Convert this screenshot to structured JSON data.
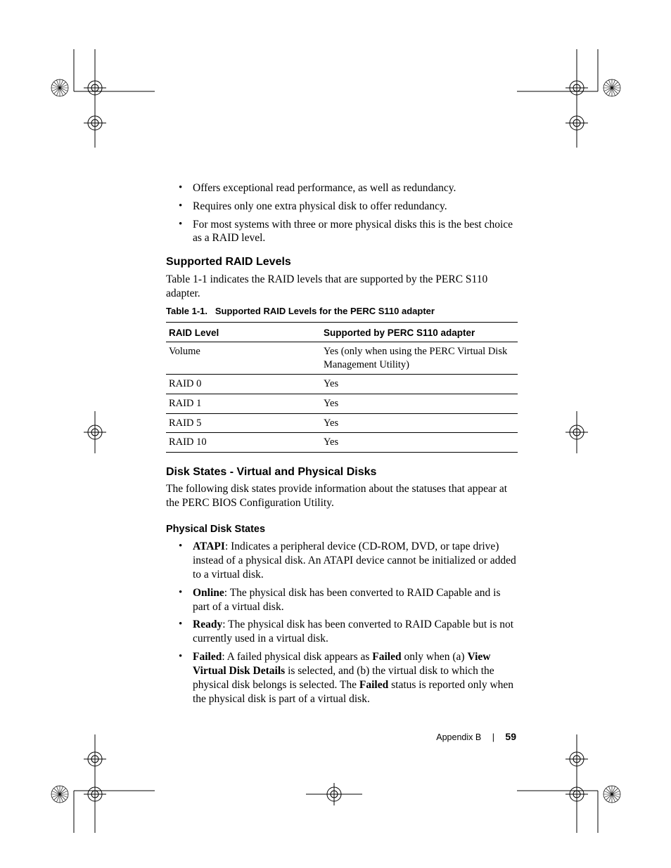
{
  "bullets_top": [
    "Offers exceptional read performance, as well as redundancy.",
    "Requires only one extra physical disk to offer redundancy.",
    "For most systems with three or more physical disks this is the best choice as a RAID level."
  ],
  "section1": {
    "heading": "Supported RAID Levels",
    "para": "Table 1-1 indicates the RAID levels that are supported by the PERC S110 adapter.",
    "table_caption_prefix": "Table 1-1.",
    "table_caption_rest": "Supported RAID Levels for the PERC S110 adapter",
    "table_headers": [
      "RAID Level",
      "Supported by PERC S110 adapter"
    ],
    "table_rows": [
      [
        "Volume",
        "Yes (only when using the PERC Virtual Disk Management Utility)"
      ],
      [
        "RAID 0",
        "Yes"
      ],
      [
        "RAID 1",
        "Yes"
      ],
      [
        "RAID 5",
        "Yes"
      ],
      [
        "RAID 10",
        "Yes"
      ]
    ]
  },
  "section2": {
    "heading": "Disk States - Virtual and Physical Disks",
    "para": "The following disk states provide information about the statuses that appear at the PERC BIOS Configuration Utility.",
    "sub_heading": "Physical Disk States",
    "items": [
      {
        "boldLead": "ATAPI",
        "rest": ": Indicates a peripheral device (CD-ROM, DVD, or tape drive) instead of a physical disk. An ATAPI device cannot be initialized or added to a virtual disk."
      },
      {
        "boldLead": "Online",
        "rest": ": The physical disk has been converted to RAID Capable and is part of a virtual disk."
      },
      {
        "boldLead": "Ready",
        "rest": ": The physical disk has been converted to RAID Capable but is not currently used in a virtual disk."
      },
      {
        "boldLead": "Failed",
        "segments": [
          {
            "t": ": A failed physical disk appears as ",
            "b": false
          },
          {
            "t": "Failed",
            "b": true
          },
          {
            "t": " only when (a) ",
            "b": false
          },
          {
            "t": "View Virtual Disk Details",
            "b": true
          },
          {
            "t": " is selected, and (b) the virtual disk to which the physical disk belongs is selected. The ",
            "b": false
          },
          {
            "t": "Failed",
            "b": true
          },
          {
            "t": " status is reported only when the physical disk is part of a virtual disk.",
            "b": false
          }
        ]
      }
    ]
  },
  "footer": {
    "label": "Appendix B",
    "page": "59"
  }
}
